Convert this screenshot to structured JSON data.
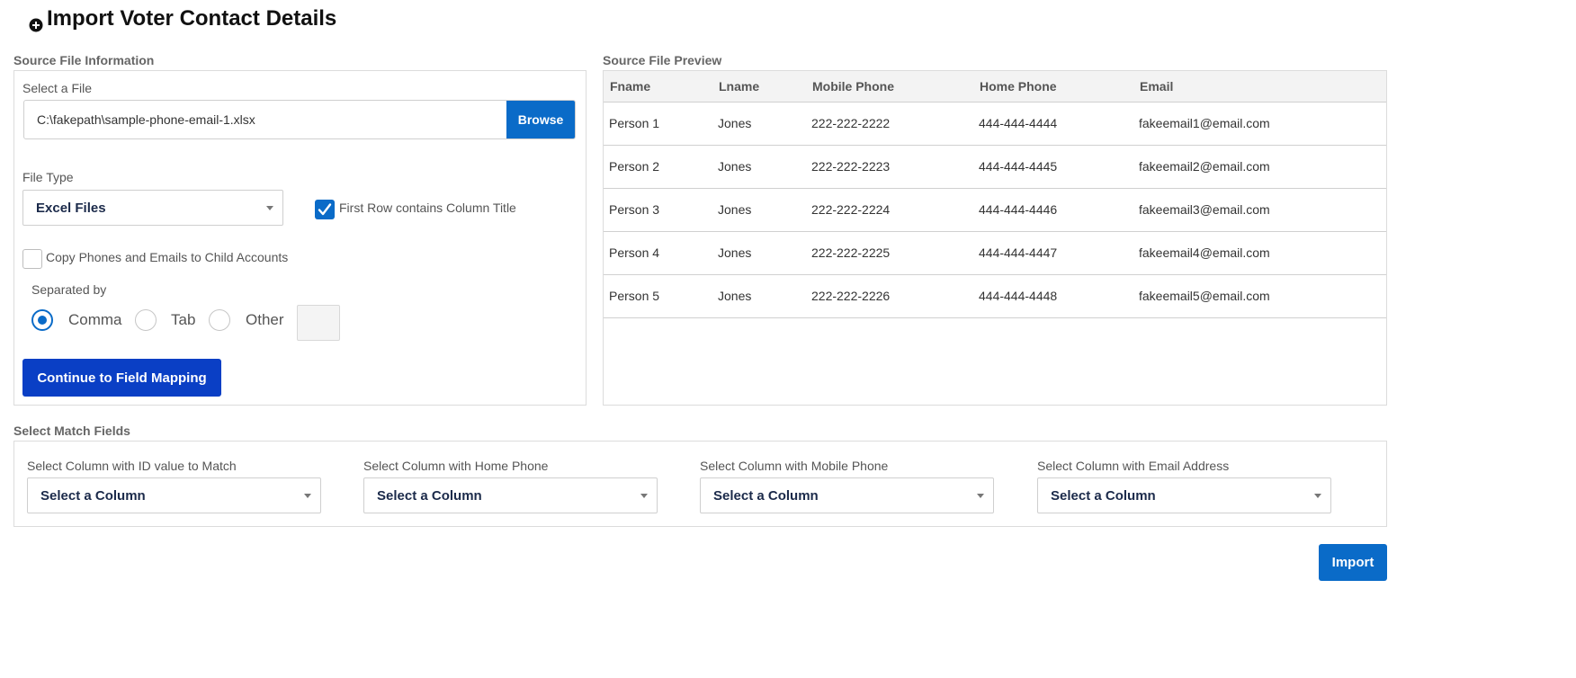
{
  "page": {
    "title": "Import Voter Contact Details"
  },
  "source_info": {
    "section_label": "Source File Information",
    "file_label": "Select a File",
    "file_path": "C:\\fakepath\\sample-phone-email-1.xlsx",
    "browse_label": "Browse",
    "file_type_label": "File Type",
    "file_type_value": "Excel Files",
    "first_row_label": "First Row contains Column Title",
    "first_row_checked": true,
    "copy_label": "Copy Phones and Emails to Child Accounts",
    "copy_checked": false,
    "separated_label": "Separated by",
    "separators": [
      {
        "label": "Comma",
        "selected": true
      },
      {
        "label": "Tab",
        "selected": false
      },
      {
        "label": "Other",
        "selected": false
      }
    ],
    "other_value": "",
    "continue_label": "Continue to Field Mapping"
  },
  "preview": {
    "section_label": "Source File Preview",
    "columns": [
      "Fname",
      "Lname",
      "Mobile Phone",
      "Home Phone",
      "Email"
    ],
    "rows": [
      [
        "Person 1",
        "Jones",
        "222-222-2222",
        "444-444-4444",
        "fakeemail1@email.com"
      ],
      [
        "Person 2",
        "Jones",
        "222-222-2223",
        "444-444-4445",
        "fakeemail2@email.com"
      ],
      [
        "Person 3",
        "Jones",
        "222-222-2224",
        "444-444-4446",
        "fakeemail3@email.com"
      ],
      [
        "Person 4",
        "Jones",
        "222-222-2225",
        "444-444-4447",
        "fakeemail4@email.com"
      ],
      [
        "Person 5",
        "Jones",
        "222-222-2226",
        "444-444-4448",
        "fakeemail5@email.com"
      ]
    ]
  },
  "match": {
    "section_label": "Select Match Fields",
    "fields": [
      {
        "label": "Select Column with ID value to Match",
        "value": "Select a Column"
      },
      {
        "label": "Select Column with Home Phone",
        "value": "Select a Column"
      },
      {
        "label": "Select Column with Mobile Phone",
        "value": "Select a Column"
      },
      {
        "label": "Select Column with Email Address",
        "value": "Select a Column"
      }
    ]
  },
  "import_label": "Import",
  "colors": {
    "primary": "#0a6bc8",
    "continue_button": "#0a3fc5"
  }
}
